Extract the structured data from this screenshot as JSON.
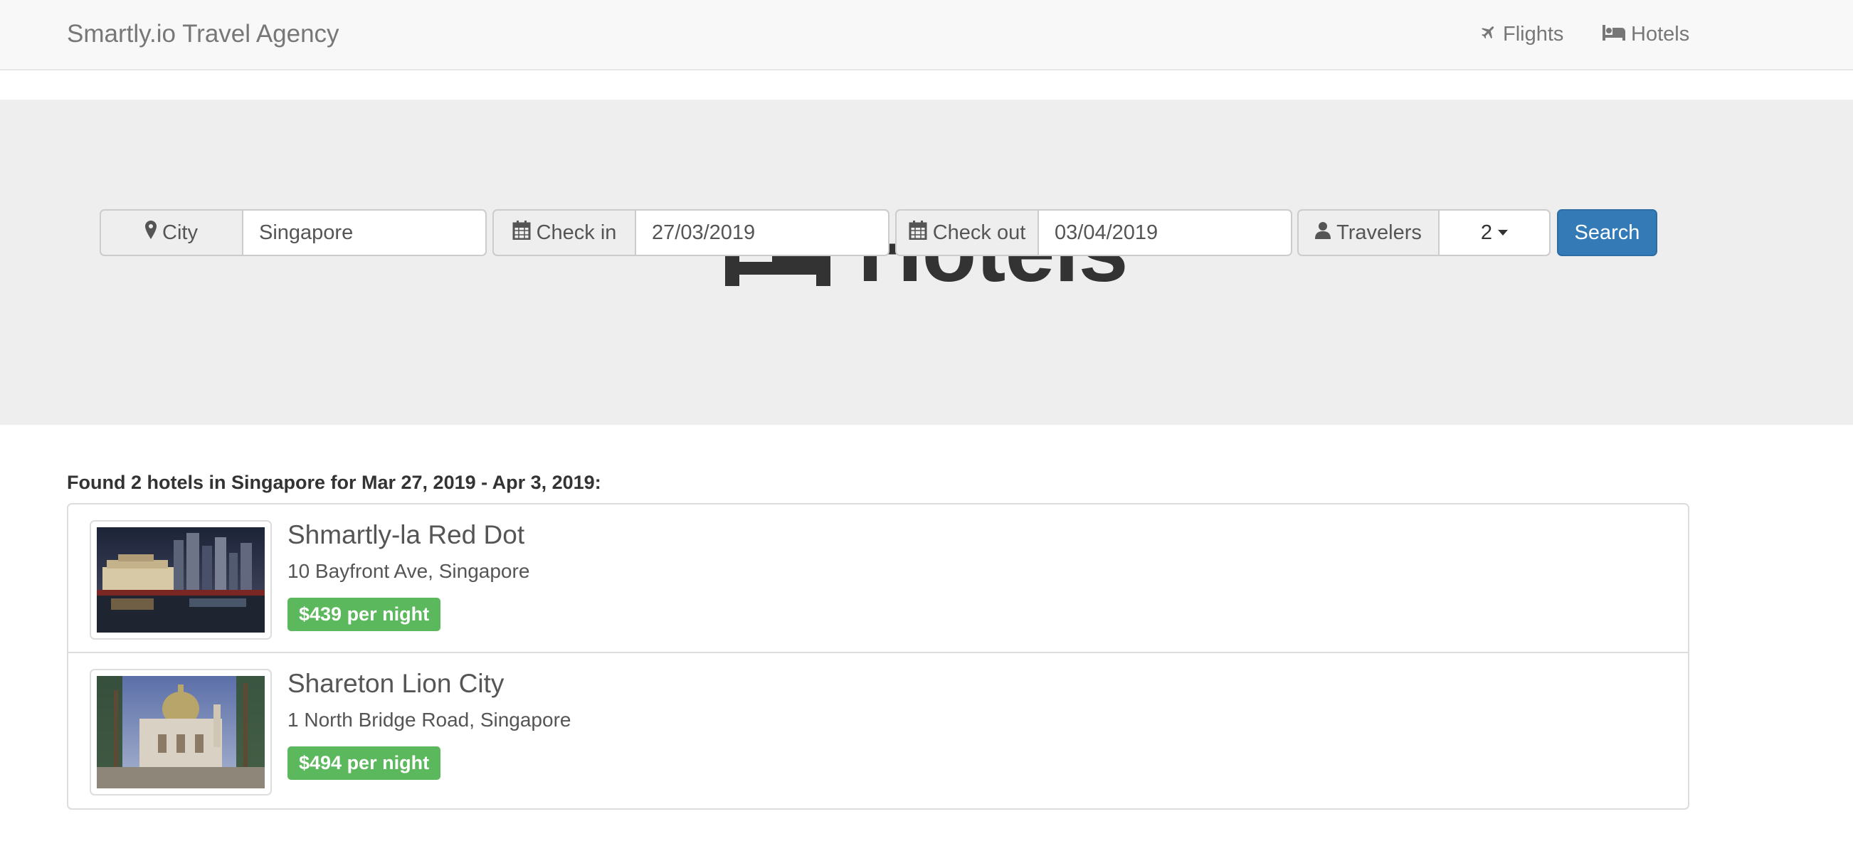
{
  "navbar": {
    "brand": "Smartly.io Travel Agency",
    "links": [
      {
        "label": "Flights",
        "icon": "plane-icon"
      },
      {
        "label": "Hotels",
        "icon": "bed-icon"
      }
    ]
  },
  "jumbotron": {
    "title": "Hotels",
    "icon": "bed-icon"
  },
  "search": {
    "city": {
      "label": "City",
      "icon": "map-marker-icon",
      "value": "Singapore"
    },
    "check_in": {
      "label": "Check in",
      "icon": "calendar-icon",
      "value": "27/03/2019"
    },
    "check_out": {
      "label": "Check out",
      "icon": "calendar-icon",
      "value": "03/04/2019"
    },
    "travelers": {
      "label": "Travelers",
      "icon": "user-icon",
      "value": "2"
    },
    "button_label": "Search",
    "button_color": "#337ab7"
  },
  "results": {
    "heading": "Found 2 hotels in Singapore for Mar 27, 2019 - Apr 3, 2019:",
    "hotels": [
      {
        "name": "Shmartly-la Red Dot",
        "address": "10 Bayfront Ave, Singapore",
        "price": "$439 per night"
      },
      {
        "name": "Shareton Lion City",
        "address": "1 North Bridge Road, Singapore",
        "price": "$494 per night"
      }
    ],
    "price_badge_color": "#5cb85c"
  }
}
